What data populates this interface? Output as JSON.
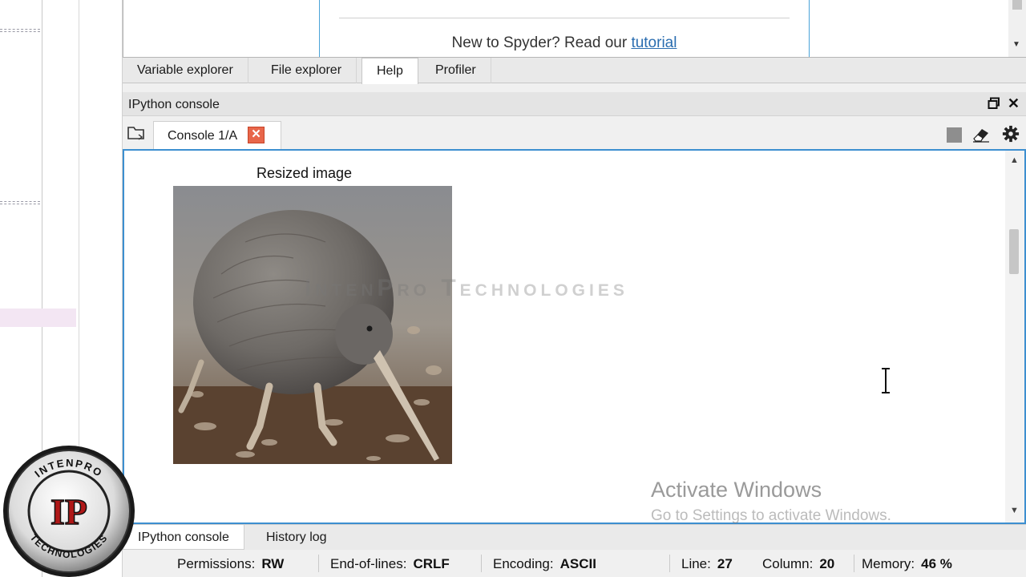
{
  "help": {
    "intro_text": "New to Spyder? Read our",
    "tutorial_link": "tutorial"
  },
  "pane_tabs": [
    "Variable explorer",
    "File explorer",
    "Help",
    "Profiler"
  ],
  "ipython": {
    "title": "IPython console",
    "console_tab": "Console 1/A",
    "close_glyph": "✕"
  },
  "figure": {
    "title": "Resized image",
    "image": "kiwi bird photo"
  },
  "watermark": "IntenPro Technologies",
  "activation": {
    "title": "Activate Windows",
    "subtitle": "Go to Settings to activate Windows."
  },
  "bottom_tabs": [
    "IPython console",
    "History log"
  ],
  "status": {
    "permissions_label": "Permissions:",
    "permissions_value": "RW",
    "eol_label": "End-of-lines:",
    "eol_value": "CRLF",
    "encoding_label": "Encoding:",
    "encoding_value": "ASCII",
    "line_label": "Line:",
    "line_value": "27",
    "column_label": "Column:",
    "column_value": "20",
    "memory_label": "Memory:",
    "memory_value": "46 %"
  },
  "logo": {
    "top_text": "INTENPRO",
    "bottom_text": "TECHNOLOGIES",
    "monogram": "IP"
  },
  "colors": {
    "accent_blue": "#3d8fd0",
    "close_red": "#e8664a",
    "link": "#2a6db0"
  }
}
